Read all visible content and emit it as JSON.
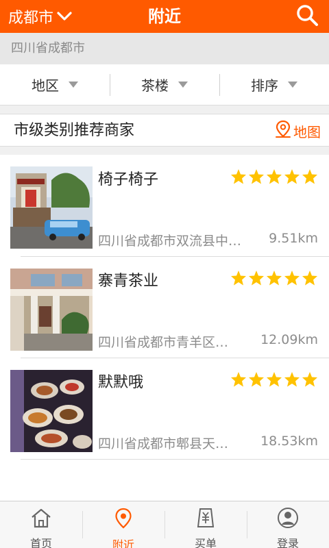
{
  "header": {
    "city": "成都市",
    "title": "附近",
    "icons": [
      "chevron-down-icon",
      "search-icon"
    ]
  },
  "location": "四川省成都市",
  "filters": [
    {
      "label": "地区"
    },
    {
      "label": "茶楼"
    },
    {
      "label": "排序"
    }
  ],
  "section": {
    "title": "市级类别推荐商家",
    "map_label": "地图"
  },
  "shops": [
    {
      "name": "椅子椅子",
      "address": "四川省成都市双流县中…",
      "distance": "9.51km",
      "rating": 5
    },
    {
      "name": "寨青茶业",
      "address": "四川省成都市青羊区…",
      "distance": "12.09km",
      "rating": 5
    },
    {
      "name": "默默哦",
      "address": "四川省成都市郫县天…",
      "distance": "18.53km",
      "rating": 5
    }
  ],
  "tabs": [
    {
      "label": "首页",
      "icon": "home-icon"
    },
    {
      "label": "附近",
      "icon": "location-pin-icon"
    },
    {
      "label": "买单",
      "icon": "receipt-icon"
    },
    {
      "label": "登录",
      "icon": "user-icon"
    }
  ],
  "colors": {
    "accent": "#ff5a00",
    "star": "#ffc200",
    "muted_text": "#8c8c8c"
  }
}
